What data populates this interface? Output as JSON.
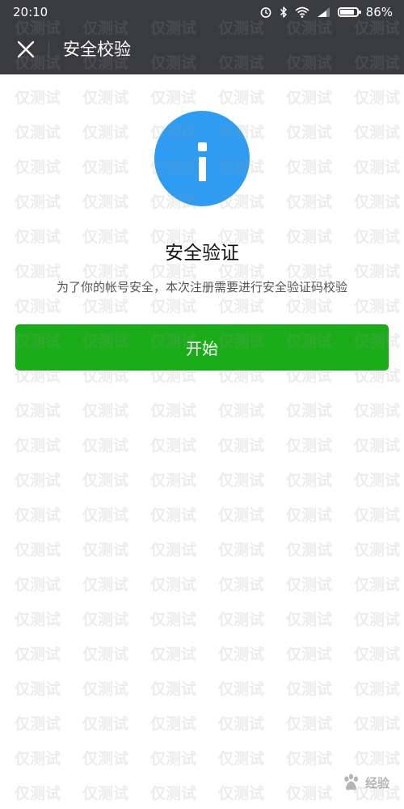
{
  "status_bar": {
    "time": "20:10",
    "battery_text": "86%",
    "battery_level": 0.86,
    "icons": [
      "alarm-icon",
      "bluetooth-icon",
      "wifi-icon",
      "signal-icon",
      "battery-icon"
    ]
  },
  "nav": {
    "title": "安全校验",
    "close_icon": "close-icon"
  },
  "content": {
    "icon": "info-icon",
    "title": "安全验证",
    "subtitle": "为了你的帐号安全，本次注册需要进行安全验证码校验",
    "start_button_label": "开始"
  },
  "watermark": {
    "text": "仅测试"
  },
  "baidu": {
    "text": "经验"
  },
  "colors": {
    "header_bg": "#3a3b3f",
    "accent_green": "#1aad19",
    "info_blue": "#2e9cf3",
    "background": "#ffffff"
  }
}
